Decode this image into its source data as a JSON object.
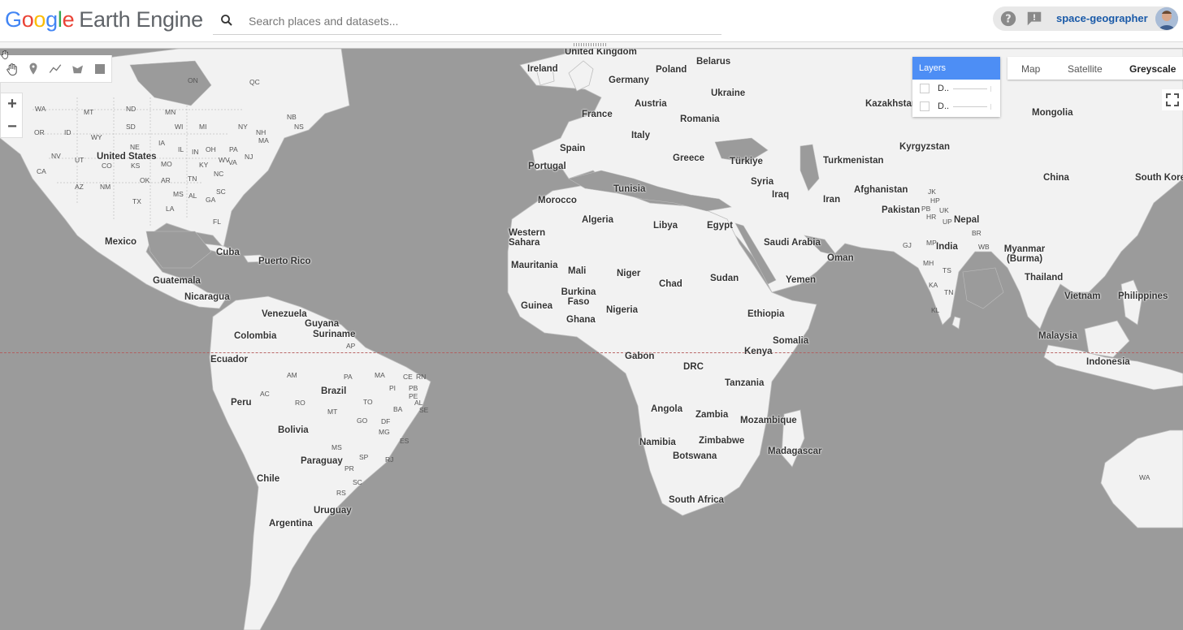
{
  "header": {
    "logo_google": [
      "G",
      "o",
      "o",
      "g",
      "l",
      "e"
    ],
    "logo_product": "Earth Engine",
    "search_placeholder": "Search places and datasets...",
    "username": "space-geographer"
  },
  "layers_panel": {
    "title": "Layers",
    "items": [
      {
        "label": "D.."
      },
      {
        "label": "D.."
      }
    ]
  },
  "map_types": {
    "options": [
      "Map",
      "Satellite",
      "Greyscale"
    ],
    "selected": "Greyscale"
  },
  "zoom": {
    "in": "+",
    "out": "−"
  },
  "draw_tools": [
    "hand-pan-icon",
    "point-marker-icon",
    "line-icon",
    "polygon-icon",
    "rectangle-icon"
  ],
  "colors": {
    "accent": "#4d8ef5",
    "ocean": "#9b9b9b",
    "land": "#f2f2f2",
    "equator": "#b45a5a"
  },
  "map_labels": {
    "countries": [
      "United Kingdom",
      "Ireland",
      "Belarus",
      "Germany",
      "Poland",
      "Austria",
      "Ukraine",
      "France",
      "Romania",
      "Kazakhstan",
      "Mongolia",
      "Italy",
      "Spain",
      "Portugal",
      "Greece",
      "Türkiye",
      "Kyrgyzstan",
      "Turkmenistan",
      "China",
      "South Korea",
      "Tunisia",
      "Syria",
      "Iraq",
      "Iran",
      "Afghanistan",
      "Pakistan",
      "Morocco",
      "Nepal",
      "Algeria",
      "Libya",
      "Egypt",
      "Western Sahara",
      "Saudi Arabia",
      "India",
      "Oman",
      "Mauritania",
      "Mali",
      "Niger",
      "Myanmar (Burma)",
      "Chad",
      "Sudan",
      "Yemen",
      "Thailand",
      "Burkina Faso",
      "Guinea",
      "Nigeria",
      "Ethiopia",
      "Vietnam",
      "Philippines",
      "Ghana",
      "Somalia",
      "Malaysia",
      "Gabon",
      "Kenya",
      "DRC",
      "Indonesia",
      "Tanzania",
      "Angola",
      "Zambia",
      "Mozambique",
      "Namibia",
      "Zimbabwe",
      "Madagascar",
      "Botswana",
      "South Africa",
      "United States",
      "Mexico",
      "Cuba",
      "Puerto Rico",
      "Guatemala",
      "Nicaragua",
      "Venezuela",
      "Guyana",
      "Suriname",
      "Colombia",
      "Ecuador",
      "Brazil",
      "Peru",
      "Bolivia",
      "Paraguay",
      "Chile",
      "Uruguay",
      "Argentina"
    ],
    "regions": [
      "ON",
      "QC",
      "WA",
      "MT",
      "ND",
      "MN",
      "NB",
      "NS",
      "OR",
      "ID",
      "SD",
      "WI",
      "MI",
      "NY",
      "WY",
      "NE",
      "IA",
      "PA",
      "NH",
      "MA",
      "NV",
      "UT",
      "CO",
      "KS",
      "MO",
      "IL",
      "IN",
      "OH",
      "KY",
      "WV",
      "VA",
      "NJ",
      "CA",
      "AZ",
      "NM",
      "OK",
      "AR",
      "TN",
      "NC",
      "TX",
      "MS",
      "AL",
      "GA",
      "SC",
      "LA",
      "FL",
      "AP",
      "AM",
      "PA",
      "MA",
      "CE",
      "RN",
      "PI",
      "PB",
      "PE",
      "AC",
      "RO",
      "TO",
      "AL",
      "BA",
      "SE",
      "MT",
      "GO",
      "DF",
      "MG",
      "ES",
      "MS",
      "SP",
      "RJ",
      "PR",
      "SC",
      "RS",
      "JK",
      "HP",
      "PB",
      "UK",
      "HR",
      "UP",
      "BR",
      "WB",
      "GJ",
      "MP",
      "MH",
      "TS",
      "KA",
      "TN",
      "KL",
      "WA"
    ]
  }
}
